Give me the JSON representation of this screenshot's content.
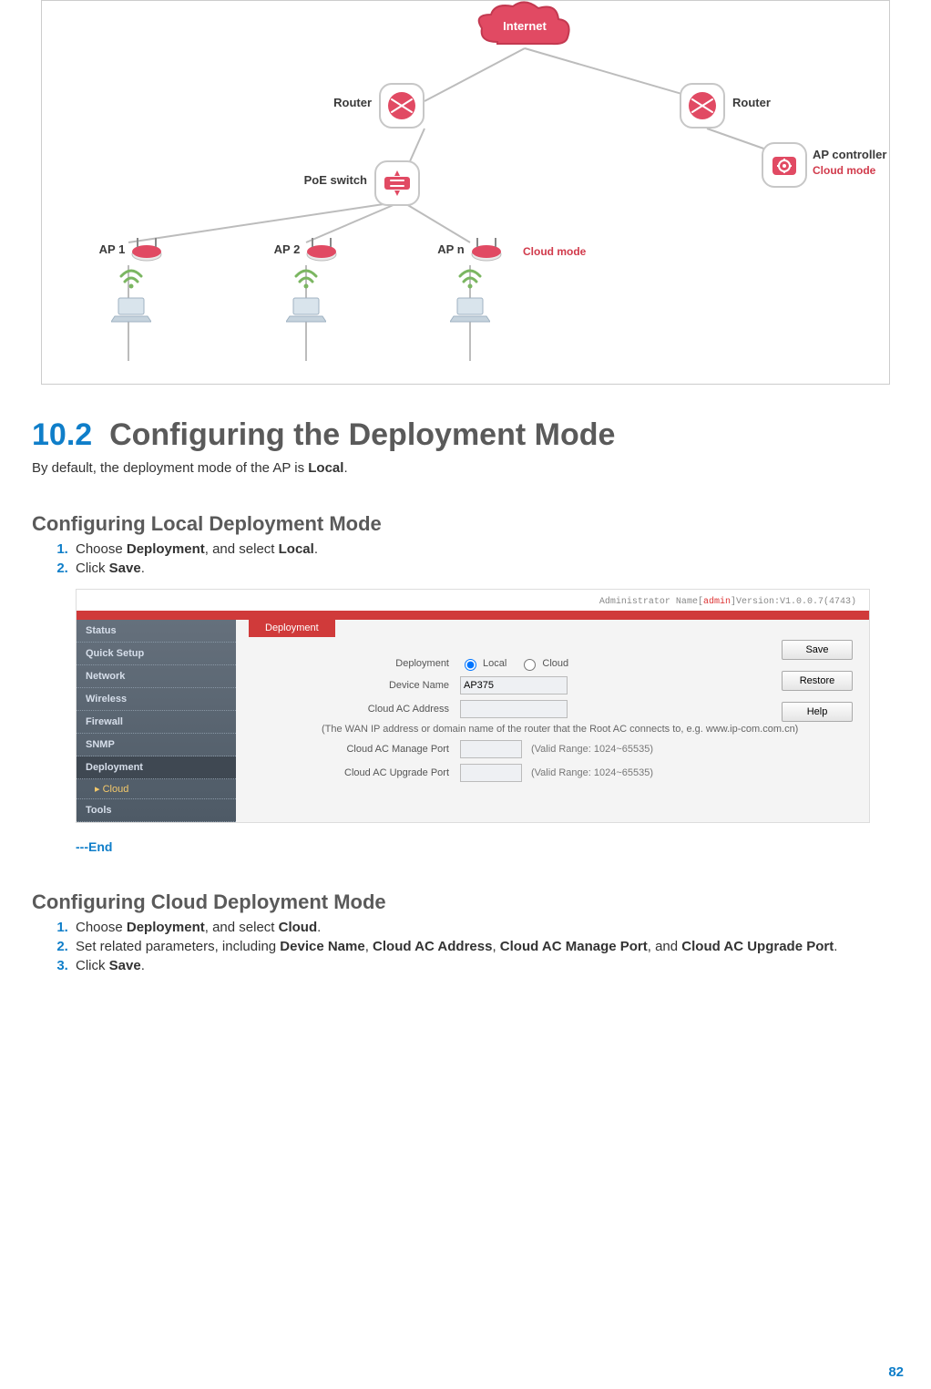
{
  "figure1": {
    "internet": "Internet",
    "router1": "Router",
    "router2": "Router",
    "poe_switch": "PoE switch",
    "ap_controller_label": "AP controller",
    "ap_controller_mode": "Cloud mode",
    "ap1": "AP 1",
    "ap2": "AP 2",
    "apn": "AP n",
    "cloud_mode_tag": "Cloud mode"
  },
  "section": {
    "number": "10.2",
    "title": "Configuring the Deployment Mode",
    "intro_pre": "By default, the deployment mode of the AP is ",
    "intro_bold": "Local",
    "intro_post": "."
  },
  "local_mode": {
    "heading": "Configuring Local Deployment Mode",
    "step1_pre": "Choose ",
    "step1_b1": "Deployment",
    "step1_mid": ", and select ",
    "step1_b2": "Local",
    "step1_post": ".",
    "step2_pre": "Click ",
    "step2_b": "Save",
    "step2_post": ".",
    "end": "---End"
  },
  "ui": {
    "admin_label": "Administrator Name[",
    "admin_name": "admin",
    "admin_ver": "]Version:V1.0.0.7(4743)",
    "sidebar": {
      "status": "Status",
      "quick": "Quick Setup",
      "network": "Network",
      "wireless": "Wireless",
      "firewall": "Firewall",
      "snmp": "SNMP",
      "deployment": "Deployment",
      "cloud_sub": "▸ Cloud",
      "tools": "Tools"
    },
    "tab": "Deployment",
    "form": {
      "deployment_label": "Deployment",
      "radio_local": "Local",
      "radio_cloud": "Cloud",
      "device_name_label": "Device Name",
      "device_name_value": "AP375",
      "cloud_addr_label": "Cloud AC Address",
      "note": "(The WAN IP address or domain name of the router that the Root AC connects to, e.g. www.ip-com.com.cn)",
      "manage_port_label": "Cloud AC Manage Port",
      "upgrade_port_label": "Cloud AC Upgrade Port",
      "range_hint": "(Valid Range: 1024~65535)"
    },
    "buttons": {
      "save": "Save",
      "restore": "Restore",
      "help": "Help"
    }
  },
  "cloud_mode": {
    "heading": "Configuring Cloud Deployment Mode",
    "step1_pre": "Choose ",
    "step1_b1": "Deployment",
    "step1_mid": ", and select ",
    "step1_b2": "Cloud",
    "step1_post": ".",
    "step2_pre": "Set related parameters, including ",
    "step2_b1": "Device Name",
    "step2_c1": ", ",
    "step2_b2": "Cloud AC Address",
    "step2_c2": ", ",
    "step2_b3": "Cloud AC Manage Port",
    "step2_c3": ", and ",
    "step2_b4": "Cloud AC Upgrade Port",
    "step2_post": ".",
    "step3_pre": "Click ",
    "step3_b": "Save",
    "step3_post": "."
  },
  "page_number": "82"
}
